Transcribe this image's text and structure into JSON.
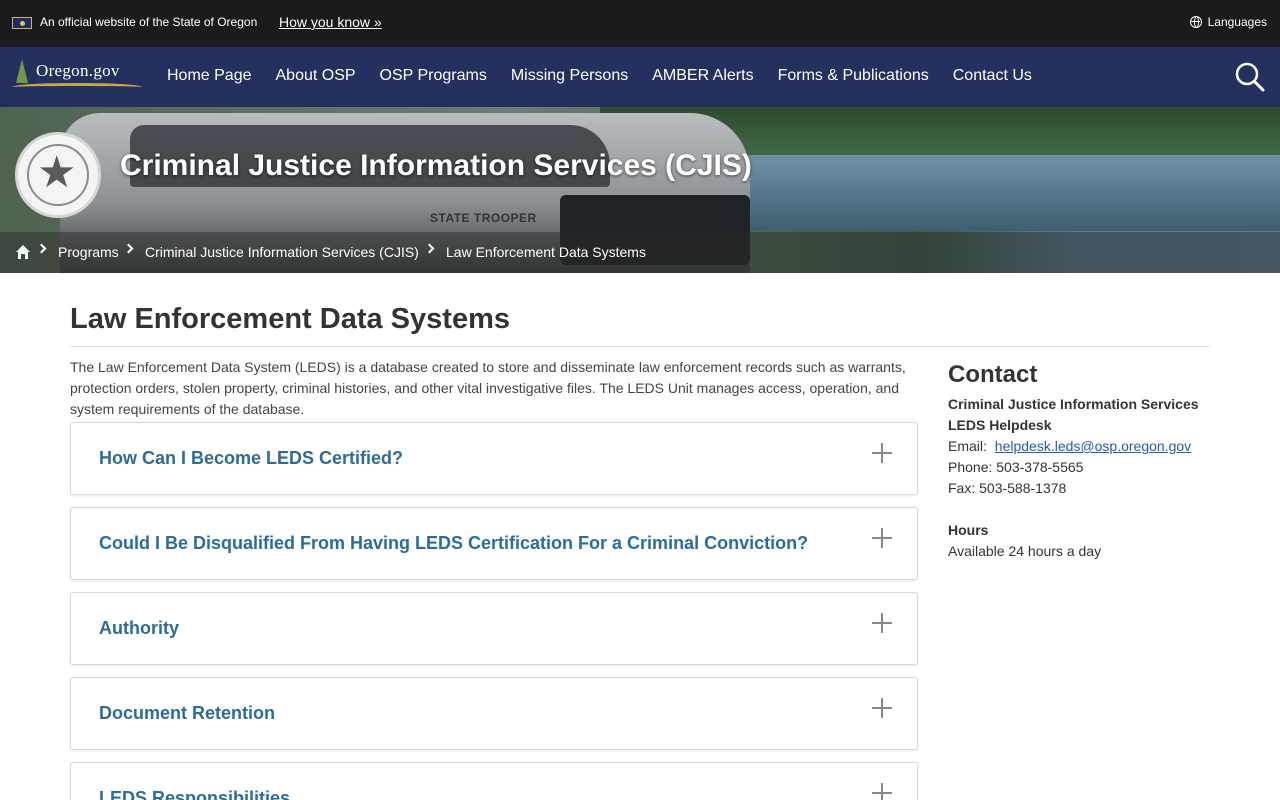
{
  "official_banner": {
    "text": "An official website of the State of Oregon",
    "how_you_know": "How you know »",
    "languages": "Languages"
  },
  "nav": {
    "logo_text": "Oregon.gov",
    "items": [
      "Home Page",
      "About OSP",
      "OSP Programs",
      "Missing Persons",
      "AMBER Alerts",
      "Forms & Publications",
      "Contact Us"
    ]
  },
  "hero": {
    "title": "Criminal Justice Information Services (CJIS)",
    "truck_label": "STATE TROOPER"
  },
  "breadcrumb": {
    "items": [
      "Programs",
      "Criminal Justice Information Services (CJIS)",
      "Law Enforcement Data Systems"
    ]
  },
  "main": {
    "title": "Law Enforcement Data Systems",
    "intro": "The Law Enforcement Data System (LEDS) is a database created to store and disseminate law enforcement records such as warrants, protection orders, stolen property, criminal histories, and other vital investigative files. The LEDS Unit manages access, operation, and system requirements of the database.",
    "accordions": [
      "How Can I Become LEDS Certified?",
      "Could I Be Disqualified From Having LEDS Certification For a Criminal Conviction?",
      "Authority",
      "Document Retention",
      "LEDS Responsibilities"
    ]
  },
  "sidebar": {
    "heading": "Contact",
    "org_line1": "Criminal Justice Information Services",
    "org_line2": "LEDS Helpdesk",
    "email_label": "Email:",
    "email": "helpdesk.leds@osp.oregon.gov",
    "phone": "Phone: 503-378-5565",
    "fax": "Fax: 503-588-1378",
    "hours_heading": "Hours",
    "hours": "Available 24 hours a day"
  },
  "colors": {
    "nav_bg": "#24305e",
    "banner_bg": "#1b1b1b",
    "accordion_title": "#2d6b9a",
    "link": "#2a5aa8"
  }
}
